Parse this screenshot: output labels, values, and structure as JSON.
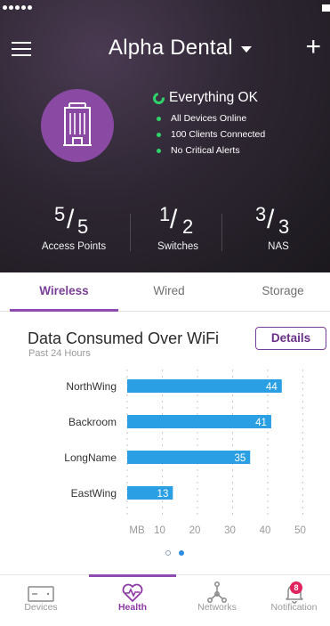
{
  "site": {
    "name": "Alpha Dental"
  },
  "health": {
    "headline": "Everything OK",
    "items": [
      "All Devices Online",
      "100 Clients Connected",
      "No Critical Alerts"
    ]
  },
  "counts": [
    {
      "value": "5",
      "total": "5",
      "label": "Access Points"
    },
    {
      "value": "1",
      "total": "2",
      "label": "Switches"
    },
    {
      "value": "3",
      "total": "3",
      "label": "NAS"
    }
  ],
  "tabs": {
    "wireless": "Wireless",
    "wired": "Wired",
    "storage": "Storage",
    "active": "Wireless"
  },
  "card": {
    "title": "Data Consumed Over WiFi",
    "subtitle": "Past 24 Hours",
    "details_label": "Details"
  },
  "chart_data": {
    "type": "bar",
    "orientation": "horizontal",
    "categories": [
      "NorthWing",
      "Backroom",
      "LongName",
      "EastWing"
    ],
    "values": [
      44,
      41,
      35,
      13
    ],
    "xlabel": "MB",
    "xticks": [
      10,
      20,
      30,
      40,
      50
    ],
    "xlim": [
      0,
      52
    ],
    "bar_color": "#2a9fe3",
    "grid": "vertical-dashed"
  },
  "pager": {
    "pages": 2,
    "active": 2
  },
  "nav": {
    "devices": "Devices",
    "health": "Health",
    "networks": "Networks",
    "notifications": "Notification",
    "notification_count": "8",
    "active": "Health"
  },
  "colors": {
    "accent": "#8e4bb0",
    "ok_green": "#2fd36a",
    "bar_blue": "#2a9fe3",
    "badge_red": "#e0245e"
  }
}
